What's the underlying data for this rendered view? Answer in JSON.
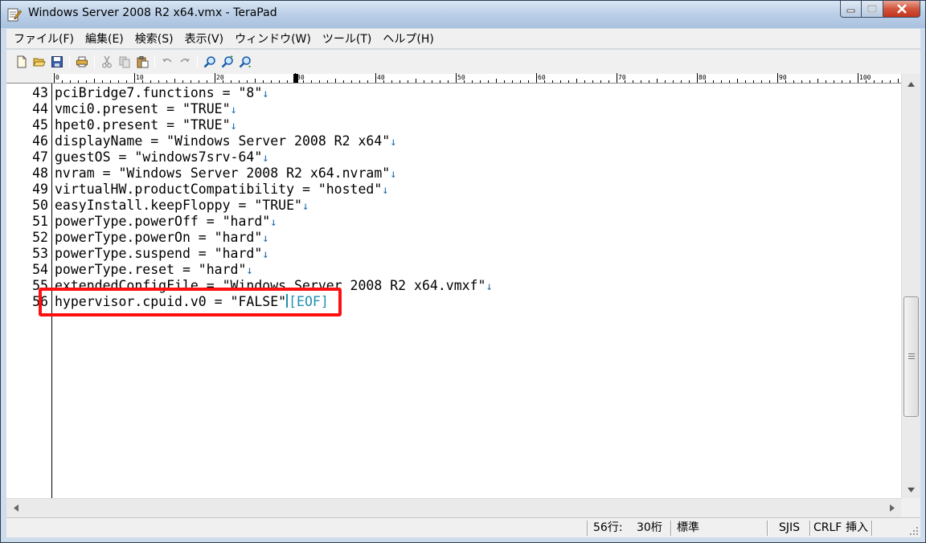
{
  "window": {
    "title": "Windows Server 2008 R2 x64.vmx - TeraPad"
  },
  "menu": [
    {
      "label": "ファイル(F)"
    },
    {
      "label": "編集(E)"
    },
    {
      "label": "検索(S)"
    },
    {
      "label": "表示(V)"
    },
    {
      "label": "ウィンドウ(W)"
    },
    {
      "label": "ツール(T)"
    },
    {
      "label": "ヘルプ(H)"
    }
  ],
  "toolbar": {
    "icons": [
      "new-file-icon",
      "open-folder-icon",
      "save-icon",
      "print-icon",
      "cut-icon",
      "copy-icon",
      "paste-icon",
      "undo-icon",
      "redo-icon",
      "find-icon",
      "find-next-icon",
      "find-prev-icon"
    ]
  },
  "ruler": {
    "marks": [
      "0",
      "10",
      "20",
      "30",
      "40",
      "50",
      "60",
      "70",
      "80",
      "90",
      "100"
    ]
  },
  "editor": {
    "newline_mark": "↓",
    "eof_mark": "[EOF]",
    "lines": [
      {
        "num": "43",
        "text": "pciBridge7.functions = \"8\""
      },
      {
        "num": "44",
        "text": "vmci0.present = \"TRUE\""
      },
      {
        "num": "45",
        "text": "hpet0.present = \"TRUE\""
      },
      {
        "num": "46",
        "text": "displayName = \"Windows Server 2008 R2 x64\""
      },
      {
        "num": "47",
        "text": "guestOS = \"windows7srv-64\""
      },
      {
        "num": "48",
        "text": "nvram = \"Windows Server 2008 R2 x64.nvram\""
      },
      {
        "num": "49",
        "text": "virtualHW.productCompatibility = \"hosted\""
      },
      {
        "num": "50",
        "text": "easyInstall.keepFloppy = \"TRUE\""
      },
      {
        "num": "51",
        "text": "powerType.powerOff = \"hard\""
      },
      {
        "num": "52",
        "text": "powerType.powerOn = \"hard\""
      },
      {
        "num": "53",
        "text": "powerType.suspend = \"hard\""
      },
      {
        "num": "54",
        "text": "powerType.reset = \"hard\""
      },
      {
        "num": "55",
        "text": "extendedConfigFile = \"Windows Server 2008 R2 x64.vmxf\""
      }
    ],
    "last_line": {
      "num": "56",
      "text": "hypervisor.cpuid.v0 = \"FALSE\""
    }
  },
  "status": {
    "line": "56行:",
    "column": "30桁",
    "mode": "標準",
    "encoding": "SJIS",
    "newline": "CRLF",
    "insert": "挿入"
  },
  "colors": {
    "highlight_box": "#ff1010",
    "eof": "#1f8fb0",
    "newline_mark": "#1f6fb2"
  }
}
